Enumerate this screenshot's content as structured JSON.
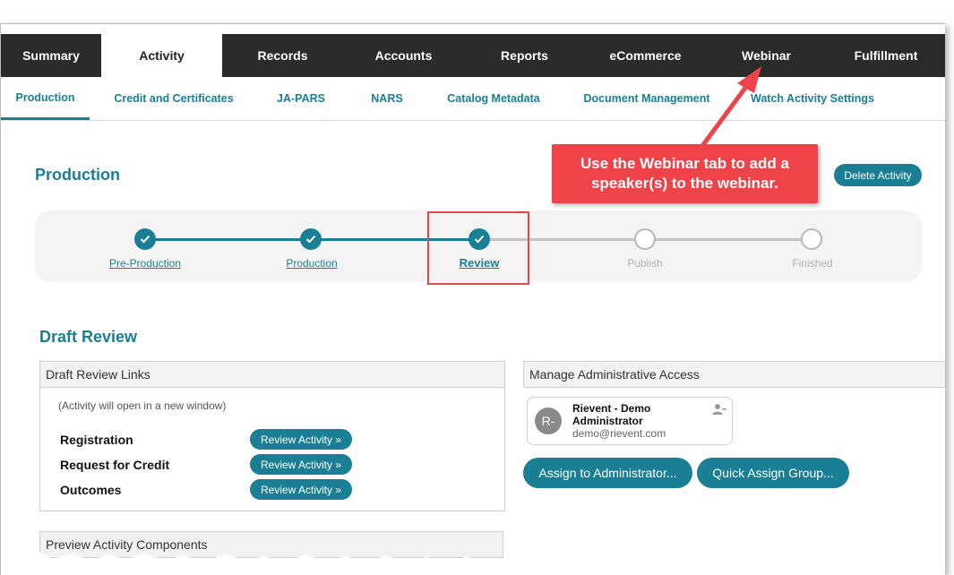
{
  "main_tabs": [
    "Summary",
    "Activity",
    "Records",
    "Accounts",
    "Reports",
    "eCommerce",
    "Webinar",
    "Fulfillment"
  ],
  "sub_tabs": [
    "Production",
    "Credit and Certificates",
    "JA-PARS",
    "NARS",
    "Catalog Metadata",
    "Document Management",
    "Watch Activity Settings"
  ],
  "page": {
    "title": "Production",
    "delete_label": "Delete Activity"
  },
  "callout": {
    "text": "Use the Webinar tab to add a speaker(s) to the webinar."
  },
  "stepper": {
    "steps": [
      {
        "label": "Pre-Production",
        "state": "done"
      },
      {
        "label": "Production",
        "state": "done"
      },
      {
        "label": "Review",
        "state": "current"
      },
      {
        "label": "Publish",
        "state": "todo"
      },
      {
        "label": "Finished",
        "state": "todo"
      }
    ]
  },
  "draft": {
    "title": "Draft Review",
    "links_header": "Draft Review Links",
    "note": "(Activity will open in a new window)",
    "rows": [
      {
        "label": "Registration",
        "button": "Review Activity »"
      },
      {
        "label": "Request for Credit",
        "button": "Review Activity »"
      },
      {
        "label": "Outcomes",
        "button": "Review Activity »"
      }
    ],
    "preview_header": "Preview Activity Components"
  },
  "admin": {
    "header": "Manage Administrative Access",
    "avatar": "R-",
    "name": "Rievent - Demo Administrator",
    "email": "demo@rievent.com",
    "assign_label": "Assign to Administrator...",
    "quick_label": "Quick Assign Group..."
  },
  "colors": {
    "brand": "#1a7f95",
    "callout": "#ee4348",
    "nav": "#2b2b2b"
  }
}
